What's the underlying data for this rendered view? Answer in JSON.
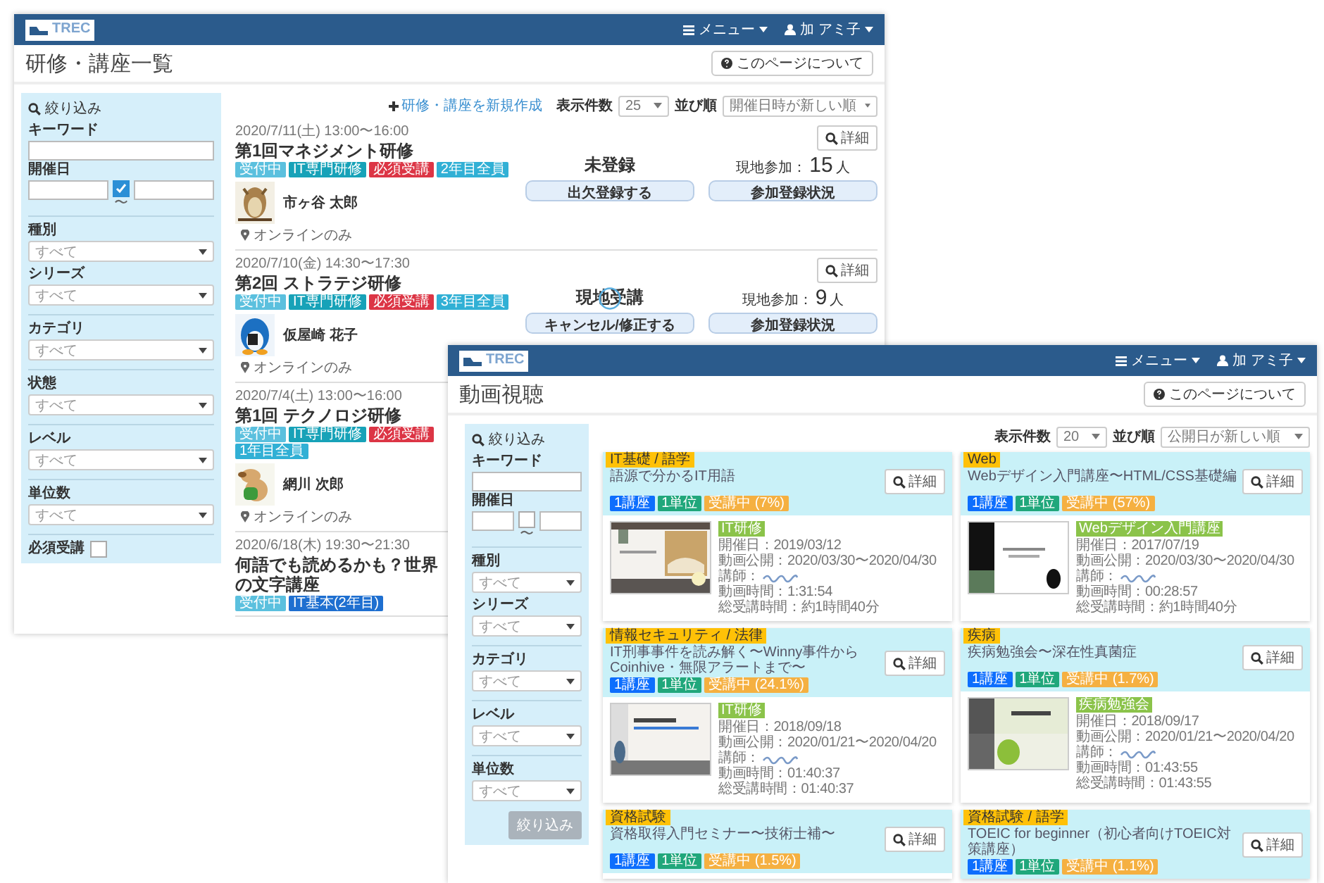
{
  "back_window": {
    "header": {
      "logo_text": "TREC",
      "menu": "メニュー",
      "user": "加 アミ子"
    },
    "title": "研修・講座一覧",
    "help_button": "このページについて",
    "filter": {
      "heading": "絞り込み",
      "keyword_label": "キーワード",
      "date_label": "開催日",
      "date_checked": true,
      "date_sep": "〜",
      "groups": [
        [
          {
            "label": "種別",
            "value": "すべて"
          },
          {
            "label": "シリーズ",
            "value": "すべて"
          }
        ],
        [
          {
            "label": "カテゴリ",
            "value": "すべて"
          }
        ],
        [
          {
            "label": "状態",
            "value": "すべて"
          }
        ],
        [
          {
            "label": "レベル",
            "value": "すべて"
          }
        ],
        [
          {
            "label": "単位数",
            "value": "すべて"
          }
        ]
      ],
      "required": {
        "label": "必須受講",
        "checked": false
      }
    },
    "toolbar": {
      "create_link": "研修・講座を新規作成",
      "count_label": "表示件数",
      "count_value": "25",
      "sort_label": "並び順",
      "sort_value": "開催日時が新しい順"
    },
    "courses": [
      {
        "date": "2020/7/11(土) 13:00〜16:00",
        "title": "第1回マネジメント研修",
        "tags": [
          {
            "text": "受付中",
            "color": "#5bc0de"
          },
          {
            "text": "IT専門研修",
            "color": "#17a2b8"
          },
          {
            "text": "必須受講",
            "color": "#dc3545"
          },
          {
            "text": "2年目全員",
            "color": "#31b0d5"
          }
        ],
        "instructor": "市ヶ谷 太郎",
        "location": "オンラインのみ",
        "detail_button": "詳細",
        "status": "未登録",
        "loading": false,
        "attendance_label": "現地参加：",
        "attendance_count": "15",
        "attendance_unit": "人",
        "buttons": [
          "出欠登録する",
          "参加登録状況"
        ]
      },
      {
        "date": "2020/7/10(金) 14:30〜17:30",
        "title": "第2回 ストラテジ研修",
        "tags": [
          {
            "text": "受付中",
            "color": "#5bc0de"
          },
          {
            "text": "IT専門研修",
            "color": "#17a2b8"
          },
          {
            "text": "必須受講",
            "color": "#dc3545"
          },
          {
            "text": "3年目全員",
            "color": "#31b0d5"
          }
        ],
        "instructor": "仮屋崎 花子",
        "location": "オンラインのみ",
        "detail_button": "詳細",
        "status": "現地受講",
        "loading": true,
        "attendance_label": "現地参加：",
        "attendance_count": "9",
        "attendance_unit": "人",
        "buttons": [
          "キャンセル/修正する",
          "参加登録状況"
        ]
      },
      {
        "date": "2020/7/4(土) 13:00〜16:00",
        "title": "第1回 テクノロジ研修",
        "tags": [
          {
            "text": "受付中",
            "color": "#5bc0de"
          },
          {
            "text": "IT専門研修",
            "color": "#17a2b8"
          },
          {
            "text": "必須受講",
            "color": "#dc3545"
          },
          {
            "text": "1年目全員",
            "color": "#31b0d5"
          }
        ],
        "instructor": "網川 次郎",
        "location": "オンラインのみ"
      },
      {
        "date": "2020/6/18(木) 19:30〜21:30",
        "title": "何語でも読めるかも？世界の文字講座",
        "tags": [
          {
            "text": "受付中",
            "color": "#5bc0de"
          },
          {
            "text": "IT基本(2年目)",
            "color": "#1e6fd0"
          }
        ]
      }
    ]
  },
  "front_window": {
    "header": {
      "logo_text": "TREC",
      "menu": "メニュー",
      "user": "加 アミ子"
    },
    "title": "動画視聴",
    "help_button": "このページについて",
    "filter": {
      "heading": "絞り込み",
      "keyword_label": "キーワード",
      "date_label": "開催日",
      "date_checked": false,
      "date_sep": "〜",
      "groups": [
        [
          {
            "label": "種別",
            "value": "すべて"
          },
          {
            "label": "シリーズ",
            "value": "すべて"
          }
        ],
        [
          {
            "label": "カテゴリ",
            "value": "すべて"
          }
        ],
        [
          {
            "label": "レベル",
            "value": "すべて"
          }
        ],
        [
          {
            "label": "単位数",
            "value": "すべて"
          }
        ]
      ],
      "submit_button": "絞り込み",
      "submit_disabled": true
    },
    "toolbar": {
      "count_label": "表示件数",
      "count_value": "20",
      "sort_label": "並び順",
      "sort_value": "公開日が新しい順"
    },
    "videos": [
      {
        "category": "IT基礎 / 語学",
        "title": "語源で分かるIT用語",
        "detail_button": "詳細",
        "tags": [
          {
            "text": "1講座",
            "color": "#0d6efd"
          },
          {
            "text": "1単位",
            "color": "#20a77b"
          },
          {
            "text": "受講中 (7%)",
            "color": "#f5b041"
          }
        ],
        "body": {
          "label": "IT研修",
          "info": [
            {
              "text": "開催日：2019/03/12",
              "redacted": false
            },
            {
              "text": "動画公開：2020/03/30〜2020/04/30",
              "redacted": false
            },
            {
              "text": "講師：",
              "redacted": true
            },
            {
              "text": "動画時間：1:31:54",
              "redacted": false
            },
            {
              "text": "総受講時間：約1時間40分",
              "redacted": false
            }
          ]
        }
      },
      {
        "category": "Web",
        "title": "Webデザイン入門講座〜HTML/CSS基礎編",
        "detail_button": "詳細",
        "tags": [
          {
            "text": "1講座",
            "color": "#0d6efd"
          },
          {
            "text": "1単位",
            "color": "#20a77b"
          },
          {
            "text": "受講中 (57%)",
            "color": "#f5b041"
          }
        ],
        "body": {
          "label": "Webデザイン入門講座",
          "info": [
            {
              "text": "開催日：2017/07/19",
              "redacted": false
            },
            {
              "text": "動画公開：2020/03/30〜2020/04/30",
              "redacted": false
            },
            {
              "text": "講師：",
              "redacted": true
            },
            {
              "text": "動画時間：00:28:57",
              "redacted": false
            },
            {
              "text": "総受講時間：約1時間40分",
              "redacted": false
            }
          ]
        }
      },
      {
        "category": "情報セキュリティ / 法律",
        "title": "IT刑事事件を読み解く〜Winny事件からCoinhive・無限アラートまで〜",
        "detail_button": "詳細",
        "tags": [
          {
            "text": "1講座",
            "color": "#0d6efd"
          },
          {
            "text": "1単位",
            "color": "#20a77b"
          },
          {
            "text": "受講中 (24.1%)",
            "color": "#f5b041"
          }
        ],
        "body": {
          "label": "IT研修",
          "info": [
            {
              "text": "開催日：2018/09/18",
              "redacted": false
            },
            {
              "text": "動画公開：2020/01/21〜2020/04/20",
              "redacted": false
            },
            {
              "text": "講師：",
              "redacted": true
            },
            {
              "text": "動画時間：01:40:37",
              "redacted": false
            },
            {
              "text": "総受講時間：01:40:37",
              "redacted": false
            }
          ]
        }
      },
      {
        "category": "疾病",
        "title": "疾病勉強会〜深在性真菌症",
        "detail_button": "詳細",
        "tags": [
          {
            "text": "1講座",
            "color": "#0d6efd"
          },
          {
            "text": "1単位",
            "color": "#20a77b"
          },
          {
            "text": "受講中 (1.7%)",
            "color": "#f5b041"
          }
        ],
        "body": {
          "label": "疾病勉強会",
          "info": [
            {
              "text": "開催日：2018/09/17",
              "redacted": false
            },
            {
              "text": "動画公開：2020/01/21〜2020/04/20",
              "redacted": false
            },
            {
              "text": "講師：",
              "redacted": true
            },
            {
              "text": "動画時間：01:43:55",
              "redacted": false
            },
            {
              "text": "総受講時間：01:43:55",
              "redacted": false
            }
          ]
        }
      },
      {
        "category": "資格試験",
        "title": "資格取得入門セミナー〜技術士補〜",
        "detail_button": "詳細",
        "tags": [
          {
            "text": "1講座",
            "color": "#0d6efd"
          },
          {
            "text": "1単位",
            "color": "#20a77b"
          },
          {
            "text": "受講中 (1.5%)",
            "color": "#f5b041"
          }
        ]
      },
      {
        "category": "資格試験 / 語学",
        "title": "TOEIC for beginner（初心者向けTOEIC対策講座）",
        "detail_button": "詳細",
        "tags": [
          {
            "text": "1講座",
            "color": "#0d6efd"
          },
          {
            "text": "1単位",
            "color": "#20a77b"
          },
          {
            "text": "受講中 (1.1%)",
            "color": "#f5b041"
          }
        ]
      }
    ]
  }
}
